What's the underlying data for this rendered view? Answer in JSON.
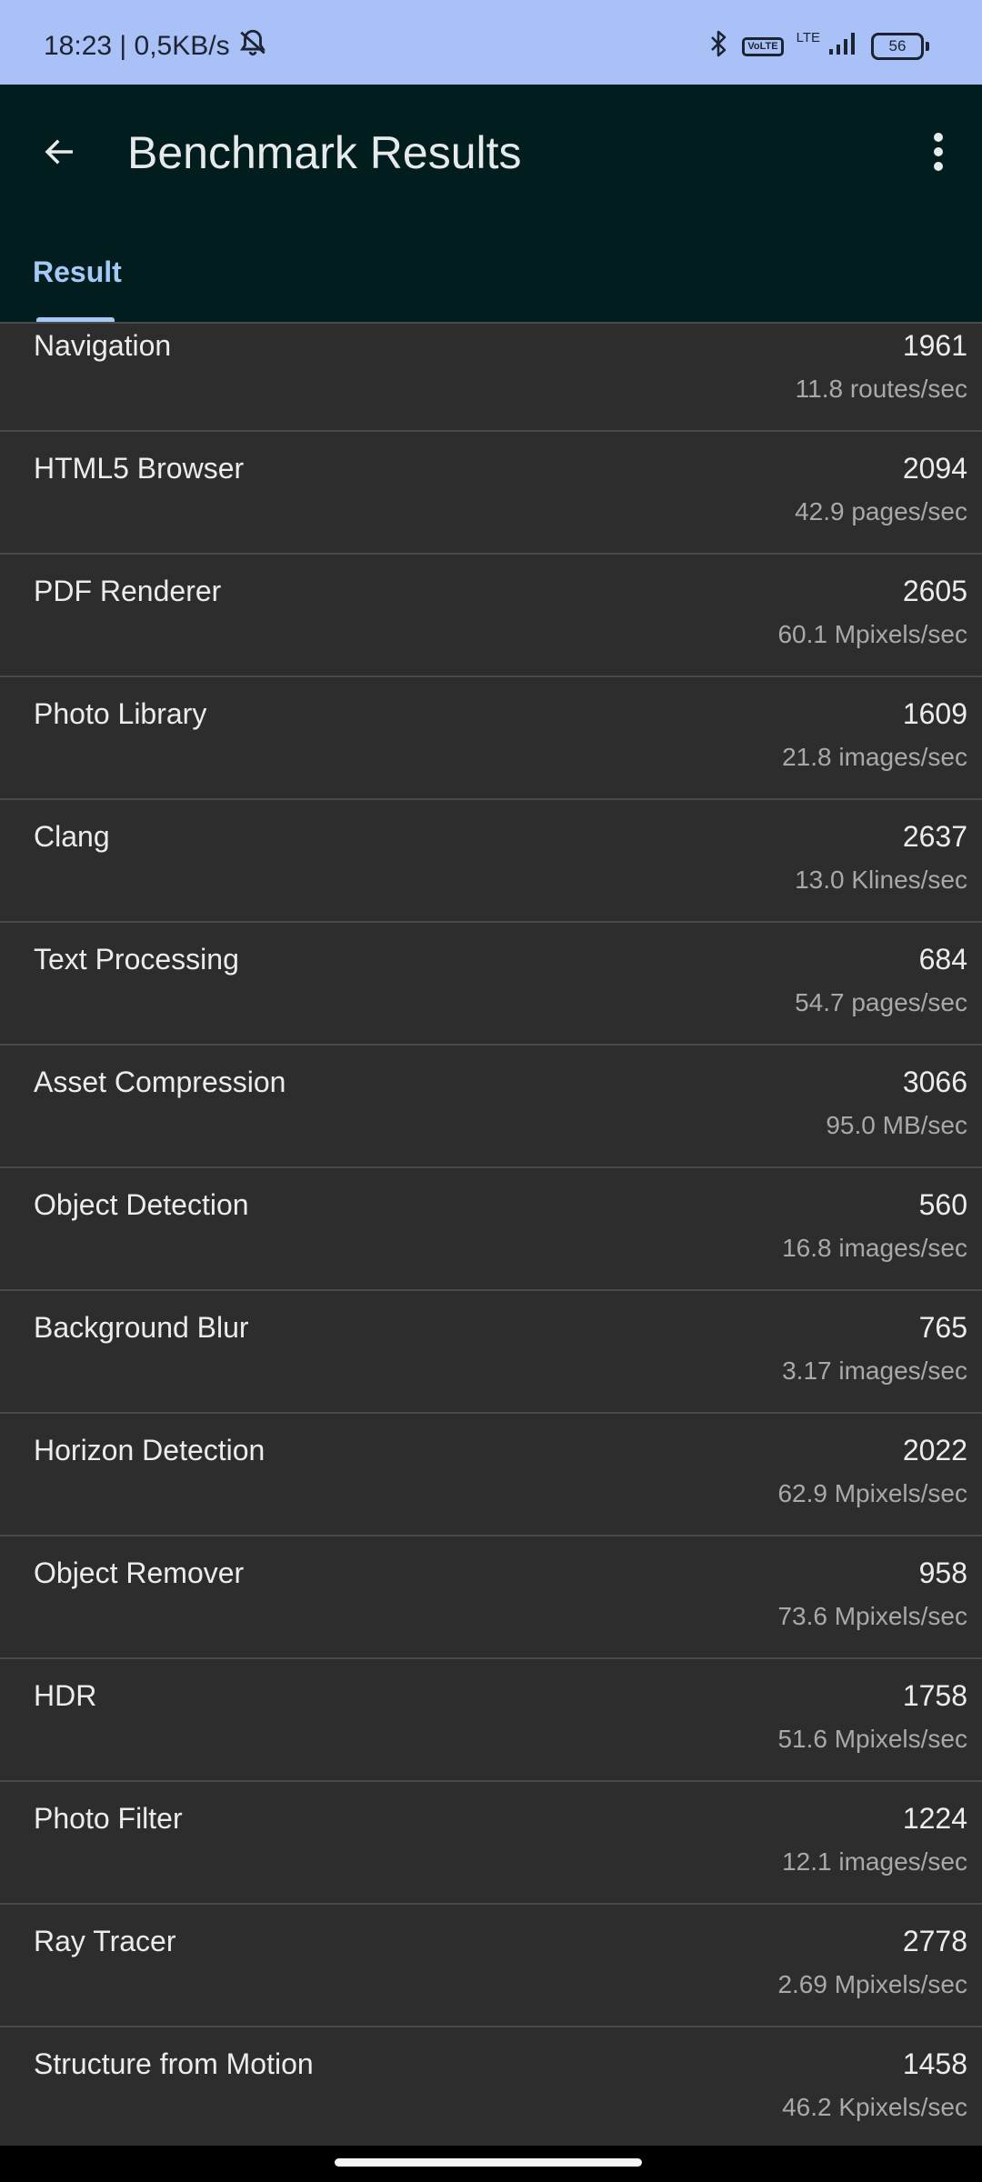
{
  "status_bar": {
    "time_speed": "18:23 | 0,5KB/s",
    "volte_label": "Vo\nLTE",
    "lte_label": "LTE",
    "battery_level": "56",
    "icons": [
      "bell-off-icon",
      "bluetooth-icon",
      "volte-icon",
      "signal-icon",
      "battery-icon"
    ]
  },
  "app_bar": {
    "title": "Benchmark Results",
    "back_icon": "arrow-back-icon",
    "menu_icon": "more-vert-icon"
  },
  "tabs": [
    {
      "label": "Result",
      "selected": true
    }
  ],
  "colors": {
    "status_bar_bg": "#a9c1f7",
    "app_bar_bg": "#021d1d",
    "list_bg": "#2d2d2d",
    "accent": "#a4c9f6"
  },
  "results": [
    {
      "name": "Navigation",
      "score": "1961",
      "rate": "11.8 routes/sec"
    },
    {
      "name": "HTML5 Browser",
      "score": "2094",
      "rate": "42.9 pages/sec"
    },
    {
      "name": "PDF Renderer",
      "score": "2605",
      "rate": "60.1 Mpixels/sec"
    },
    {
      "name": "Photo Library",
      "score": "1609",
      "rate": "21.8 images/sec"
    },
    {
      "name": "Clang",
      "score": "2637",
      "rate": "13.0 Klines/sec"
    },
    {
      "name": "Text Processing",
      "score": "684",
      "rate": "54.7 pages/sec"
    },
    {
      "name": "Asset Compression",
      "score": "3066",
      "rate": "95.0 MB/sec"
    },
    {
      "name": "Object Detection",
      "score": "560",
      "rate": "16.8 images/sec"
    },
    {
      "name": "Background Blur",
      "score": "765",
      "rate": "3.17 images/sec"
    },
    {
      "name": "Horizon Detection",
      "score": "2022",
      "rate": "62.9 Mpixels/sec"
    },
    {
      "name": "Object Remover",
      "score": "958",
      "rate": "73.6 Mpixels/sec"
    },
    {
      "name": "HDR",
      "score": "1758",
      "rate": "51.6 Mpixels/sec"
    },
    {
      "name": "Photo Filter",
      "score": "1224",
      "rate": "12.1 images/sec"
    },
    {
      "name": "Ray Tracer",
      "score": "2778",
      "rate": "2.69 Mpixels/sec"
    },
    {
      "name": "Structure from Motion",
      "score": "1458",
      "rate": "46.2 Kpixels/sec"
    }
  ]
}
